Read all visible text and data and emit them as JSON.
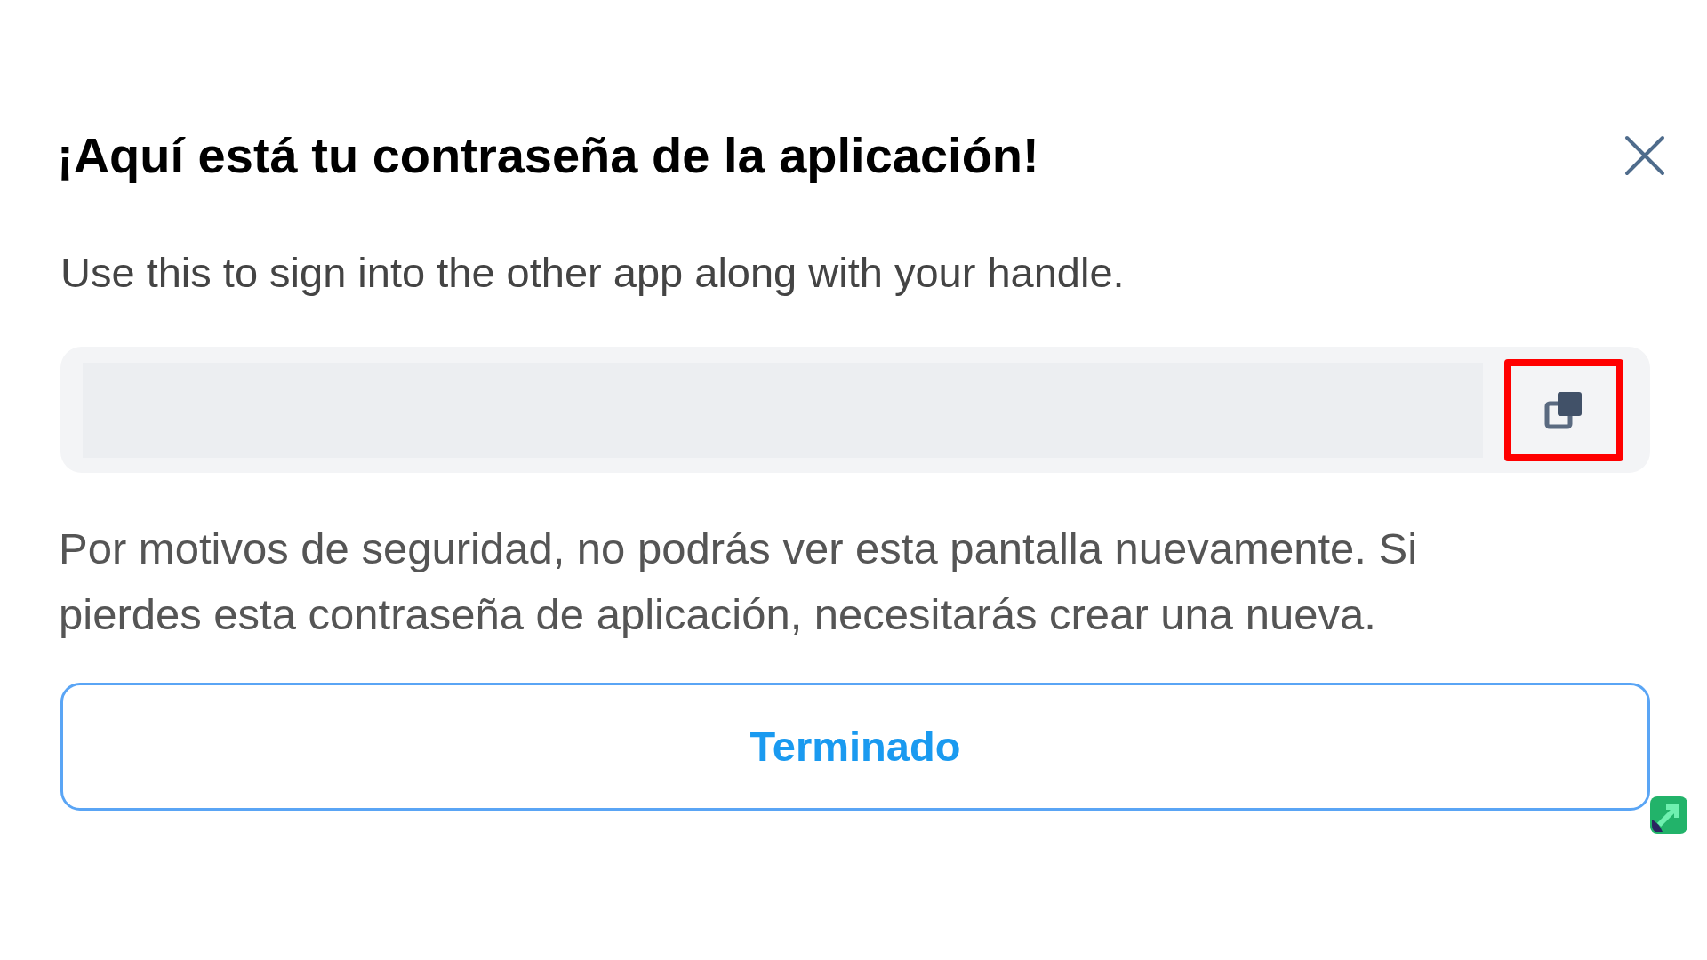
{
  "dialog": {
    "title": "¡Aquí está tu contraseña de la aplicación!",
    "subtitle": "Use this to sign into the other app along with your handle.",
    "copy_button": {
      "highlighted": true
    },
    "notice": "Por motivos de seguridad, no podrás ver esta pantalla nuevamente. Si pierdes esta contraseña de aplicación, necesitarás crear una nueva.",
    "done_button": "Terminado"
  }
}
